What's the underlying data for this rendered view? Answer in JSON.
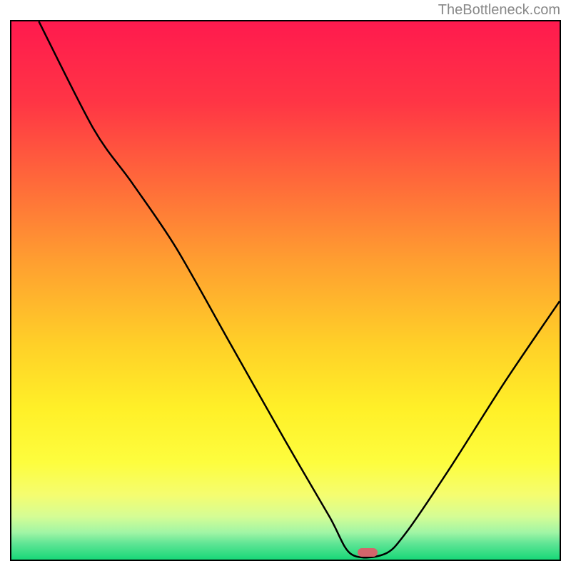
{
  "watermark": "TheBottleneck.com",
  "chart_data": {
    "type": "line",
    "title": "",
    "xlabel": "",
    "ylabel": "",
    "xlim": [
      0,
      100
    ],
    "ylim": [
      0,
      100
    ],
    "curve_points": [
      {
        "x": 5,
        "y": 100
      },
      {
        "x": 15,
        "y": 80
      },
      {
        "x": 22,
        "y": 70
      },
      {
        "x": 30,
        "y": 58
      },
      {
        "x": 40,
        "y": 40
      },
      {
        "x": 50,
        "y": 22
      },
      {
        "x": 58,
        "y": 8
      },
      {
        "x": 62,
        "y": 1
      },
      {
        "x": 68,
        "y": 1
      },
      {
        "x": 72,
        "y": 5
      },
      {
        "x": 80,
        "y": 17
      },
      {
        "x": 90,
        "y": 33
      },
      {
        "x": 100,
        "y": 48
      }
    ],
    "marker_position": {
      "x": 65,
      "y": 1.3
    },
    "gradient_stops": [
      {
        "offset": 0,
        "color": "#ff1a4e"
      },
      {
        "offset": 15,
        "color": "#ff3545"
      },
      {
        "offset": 30,
        "color": "#ff6a3a"
      },
      {
        "offset": 45,
        "color": "#ffa030"
      },
      {
        "offset": 60,
        "color": "#ffd028"
      },
      {
        "offset": 72,
        "color": "#fff028"
      },
      {
        "offset": 82,
        "color": "#fdfd3e"
      },
      {
        "offset": 88,
        "color": "#f5fd70"
      },
      {
        "offset": 92,
        "color": "#d5fd95"
      },
      {
        "offset": 95,
        "color": "#a0f5a5"
      },
      {
        "offset": 97,
        "color": "#60e595"
      },
      {
        "offset": 100,
        "color": "#18d878"
      }
    ]
  }
}
